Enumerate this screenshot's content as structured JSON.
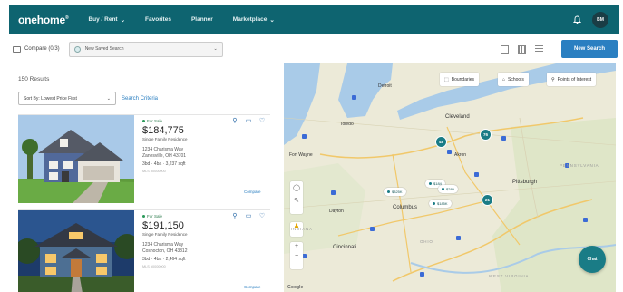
{
  "app": {
    "logo": "onehome"
  },
  "nav": {
    "items": [
      {
        "label": "Buy / Rent",
        "has_dropdown": true
      },
      {
        "label": "Favorites",
        "has_dropdown": false
      },
      {
        "label": "Planner",
        "has_dropdown": false
      },
      {
        "label": "Marketplace",
        "has_dropdown": true
      }
    ],
    "avatar_initials": "BM",
    "icons": {
      "notifications": "bell-icon"
    },
    "color": "#0e6470"
  },
  "toolbar": {
    "compare_label": "Compare (0/3)",
    "saved_search_value": "New Saved Search",
    "view_icons": [
      "map-view-icon",
      "grid-view-icon",
      "list-view-icon"
    ],
    "new_search_label": "New Search",
    "accent": "#2a7fc1"
  },
  "list": {
    "results_count": "150 Results",
    "sort_value": "Sort By: Lowest Price First",
    "criteria_link": "Search Criteria",
    "listings": [
      {
        "status": "For Sale",
        "price": "$184,775",
        "type": "Single Family Residence",
        "address_line1": "1234 Charisma Way",
        "address_line2": "Zanesville, OH 43701",
        "specs": "3bd · 4ba · 3,237 sqft",
        "mls": "MLS #0000000",
        "compare_label": "Compare"
      },
      {
        "status": "For Sale",
        "price": "$191,150",
        "type": "Single Family Residence",
        "address_line1": "1234 Charisma Way",
        "address_line2": "Coshocton, OH 43812",
        "specs": "3bd · 4ba · 2,464 sqft",
        "mls": "MLS #0000000",
        "compare_label": "Compare"
      }
    ]
  },
  "map": {
    "buttons": {
      "boundaries": "Boundaries",
      "schools": "Schools",
      "poi": "Points of Interest"
    },
    "clusters": [
      "48",
      "76",
      "21"
    ],
    "price_pins": [
      "$184",
      "$325K",
      "$289",
      "$185K"
    ],
    "cities": [
      "Detroit",
      "Toledo",
      "Cleveland",
      "Akron",
      "Pittsburgh",
      "Columbus",
      "Cincinnati",
      "Dayton",
      "Fort Wayne"
    ],
    "states": [
      "OHIO",
      "PENNSYLVANIA",
      "INDIANA",
      "WEST VIRGINIA"
    ],
    "chat_label": "Chat",
    "attribution": "Google"
  }
}
